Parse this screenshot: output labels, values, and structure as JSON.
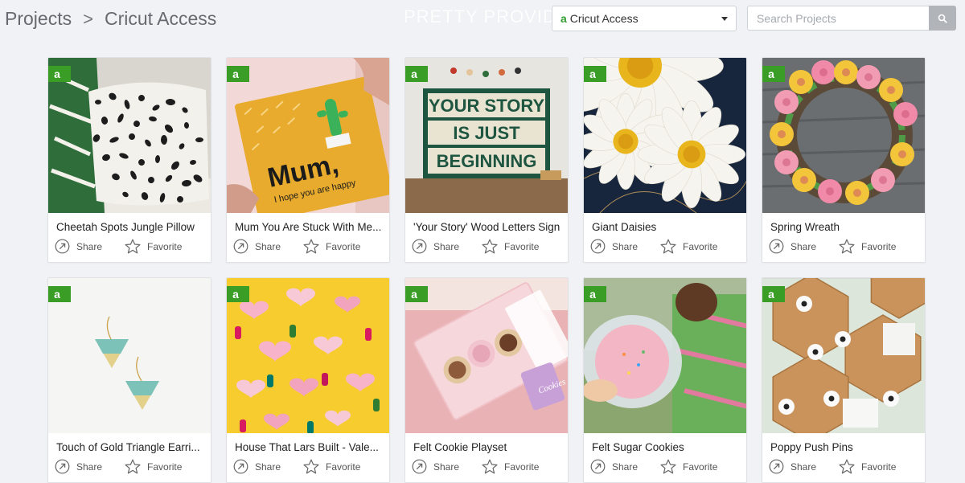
{
  "breadcrumb": {
    "root": "Projects",
    "separator": ">",
    "current": "Cricut Access"
  },
  "watermark": "PRETTY PROVIDENCE",
  "filter": {
    "badge_icon": "a",
    "selected": "Cricut Access"
  },
  "search": {
    "placeholder": "Search Projects",
    "value": ""
  },
  "colors": {
    "badge_green": "#3a9d26",
    "page_bg": "#f0f2f5"
  },
  "actions": {
    "share": "Share",
    "favorite": "Favorite"
  },
  "projects": [
    {
      "title": "Cheetah Spots Jungle Pillow",
      "art": "cheetah-pillow"
    },
    {
      "title": "Mum You Are Stuck With Me...",
      "art": "mum-card",
      "thumb_text": [
        "Mum,",
        "I hope you are happy"
      ]
    },
    {
      "title": "'Your Story' Wood Letters Sign",
      "art": "story-sign",
      "thumb_text": [
        "YOUR STORY",
        "IS JUST",
        "BEGINNING"
      ]
    },
    {
      "title": "Giant Daisies",
      "art": "daisies"
    },
    {
      "title": "Spring Wreath",
      "art": "wreath"
    },
    {
      "title": "Touch of Gold Triangle Earri...",
      "art": "earrings"
    },
    {
      "title": "House That Lars Built - Vale...",
      "art": "hearts"
    },
    {
      "title": "Felt Cookie Playset",
      "art": "cookie-box",
      "thumb_text": [
        "Cookies"
      ]
    },
    {
      "title": "Felt Sugar Cookies",
      "art": "sugar-cookie"
    },
    {
      "title": "Poppy Push Pins",
      "art": "push-pins"
    }
  ]
}
